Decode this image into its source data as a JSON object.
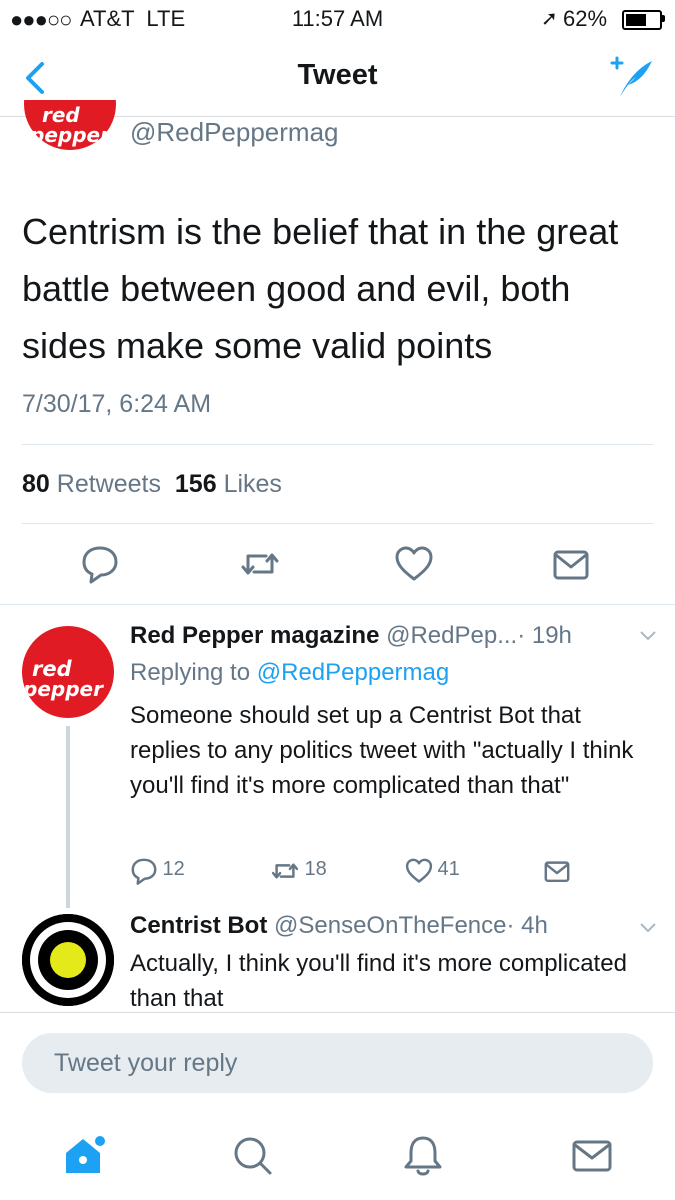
{
  "status_bar": {
    "signal": "●●●○○",
    "carrier": "AT&T  LTE",
    "time": "11:57 AM",
    "battery": "62%",
    "battery_level": 0.62
  },
  "nav": {
    "title": "Tweet",
    "back_icon": "chevron-left-icon",
    "compose_icon": "compose-tweet-icon"
  },
  "main_tweet": {
    "avatar_text": "red pepper",
    "handle": "@RedPeppermag",
    "text": "Centrism is the belief that in the great battle between good and evil, both sides make some valid points",
    "timestamp": "7/30/17, 6:24 AM",
    "retweets_count": "80",
    "retweets_label": "Retweets",
    "likes_count": "156",
    "likes_label": "Likes"
  },
  "replies": [
    {
      "avatar_text": "red pepper",
      "name": "Red Pepper magazine",
      "handle": "@RedPep...",
      "time": "· 19h",
      "replying_prefix": "Replying to",
      "replying_to": "@RedPeppermag",
      "text": "Someone should set up a Centrist Bot that replies to any politics tweet with \"actually I think you'll find it's more complicated than that\"",
      "reply_count": "12",
      "retweet_count": "18",
      "like_count": "41"
    },
    {
      "name": "Centrist Bot",
      "handle": "@SenseOnTheFence",
      "time": "· 4h",
      "text": "Actually, I think you'll find it's more complicated than that"
    }
  ],
  "reply_box": {
    "placeholder": "Tweet your reply"
  },
  "tab_bar": [
    "home-icon",
    "search-icon",
    "notifications-icon",
    "messages-icon"
  ],
  "colors": {
    "accent": "#1da1f2",
    "brand_red": "#e01b24",
    "bot_yellow": "#e4ea1a"
  }
}
